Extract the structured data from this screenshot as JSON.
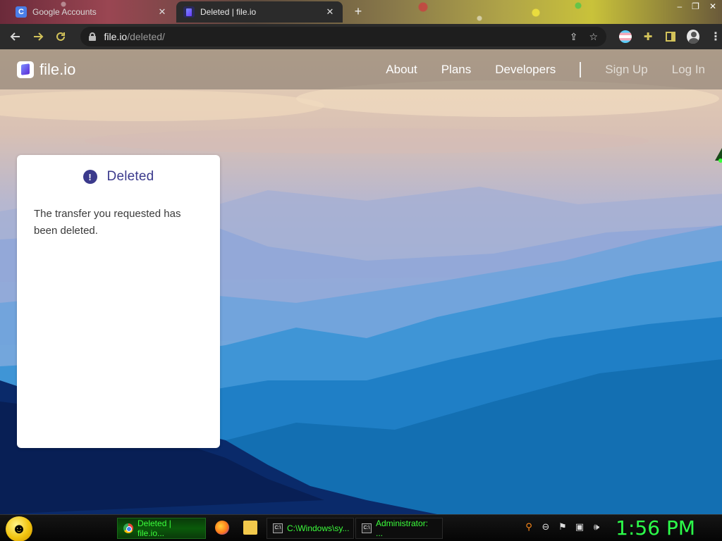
{
  "browser": {
    "tabs": [
      {
        "title": "Google Accounts",
        "favicon": "google-accounts-favicon",
        "active": false
      },
      {
        "title": "Deleted | file.io",
        "favicon": "fileio-favicon",
        "active": true
      }
    ],
    "new_tab_label": "+",
    "window_controls": [
      "–",
      "❐",
      "✕"
    ],
    "url_host": "file.io",
    "url_path": "/deleted/"
  },
  "site": {
    "logo_text": "file.io",
    "nav": {
      "about": "About",
      "plans": "Plans",
      "developers": "Developers",
      "sign_up": "Sign Up",
      "log_in": "Log In"
    }
  },
  "card": {
    "icon_glyph": "!",
    "title": "Deleted",
    "message": "The transfer you requested has been deleted."
  },
  "taskbar": {
    "buttons": [
      {
        "label": "Deleted | file.io...",
        "icon": "chrome-icon",
        "active": true
      },
      {
        "label": "C:\\Windows\\sy...",
        "icon": "cmd-icon",
        "active": false
      },
      {
        "label": "Administrator: ...",
        "icon": "cmd-icon",
        "active": false
      }
    ],
    "clock": "1:56 PM"
  },
  "colors": {
    "accent": "#3b3a8c",
    "clock": "#2cff4a",
    "taskbar_text": "#3cff3c"
  }
}
